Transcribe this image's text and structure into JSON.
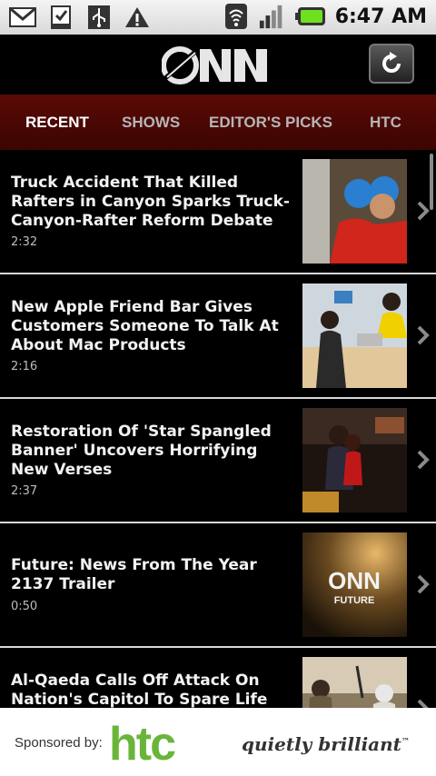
{
  "status_bar": {
    "time": "6:47 AM",
    "left_icons": [
      "gmail-icon",
      "download-icon",
      "usb-icon",
      "warning-icon"
    ],
    "right_icons": [
      "wifi-icon",
      "signal-icon",
      "battery-icon"
    ]
  },
  "header": {
    "logo_text": "ONN",
    "refresh_icon": "refresh-icon"
  },
  "tabs": [
    {
      "label": "RECENT",
      "active": true
    },
    {
      "label": "SHOWS",
      "active": false
    },
    {
      "label": "EDITOR'S PICKS",
      "active": false
    },
    {
      "label": "HTC",
      "active": false
    }
  ],
  "videos": [
    {
      "title": "Truck Accident That Killed Rafters in Canyon Sparks Truck-Canyon-Rafter Reform Debate",
      "duration": "2:32"
    },
    {
      "title": "New Apple Friend Bar Gives Customers Someone To Talk At About Mac Products",
      "duration": "2:16"
    },
    {
      "title": "Restoration Of 'Star Spangled Banner' Uncovers Horrifying New Verses",
      "duration": "2:37"
    },
    {
      "title": "Future: News From The Year 2137 Trailer",
      "duration": "0:50"
    },
    {
      "title": "Al-Qaeda Calls Off Attack On Nation's Capitol To Spare Life Of",
      "duration": ""
    }
  ],
  "thumb_texts": {
    "future_logo": "ONN",
    "future_label": "FUTURE"
  },
  "sponsor": {
    "label": "Sponsored by:",
    "brand": "htc",
    "tagline": "quietly brilliant",
    "trademark": "™"
  },
  "colors": {
    "tab_bar": "#4a0803",
    "htc_green": "#69b53a"
  }
}
